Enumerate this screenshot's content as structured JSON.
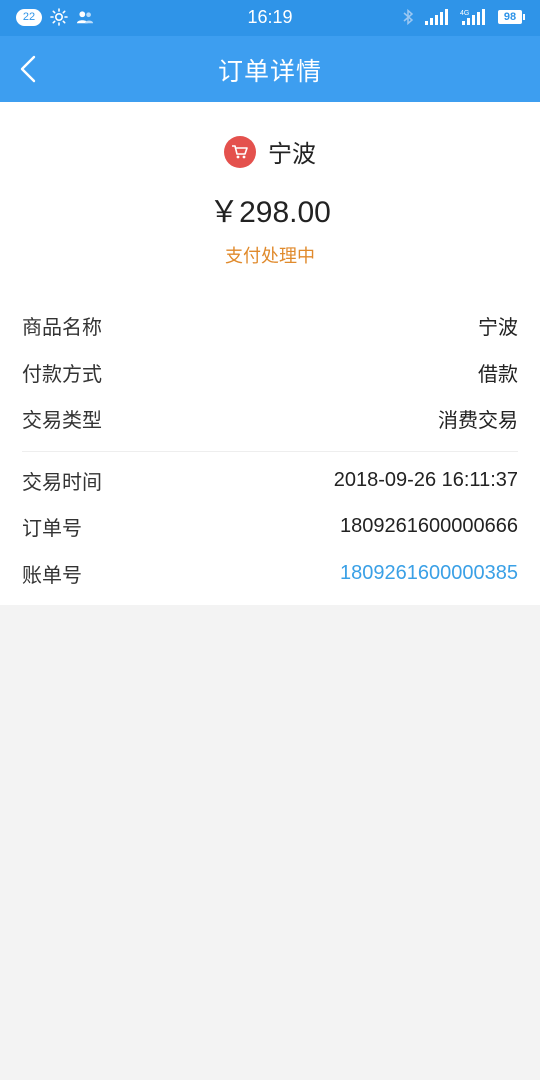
{
  "status_bar": {
    "notification_count": "22",
    "time": "16:19",
    "battery": "98",
    "network_label": "4G"
  },
  "app_bar": {
    "title": "订单详情"
  },
  "summary": {
    "merchant": "宁波",
    "amount": "￥298.00",
    "status": "支付处理中",
    "status_color": "#e08a2c",
    "merchant_icon": "shopping-cart-icon"
  },
  "details": [
    {
      "label": "商品名称",
      "value": "宁波"
    },
    {
      "label": "付款方式",
      "value": "借款"
    },
    {
      "label": "交易类型",
      "value": "消费交易"
    },
    {
      "label": "交易时间",
      "value": "2018-09-26 16:11:37"
    },
    {
      "label": "订单号",
      "value": "1809261600000666"
    },
    {
      "label": "账单号",
      "value": "1809261600000385"
    }
  ],
  "colors": {
    "header": "#3d9ef0",
    "link": "#3aa0e6",
    "cart": "#e4514d"
  }
}
